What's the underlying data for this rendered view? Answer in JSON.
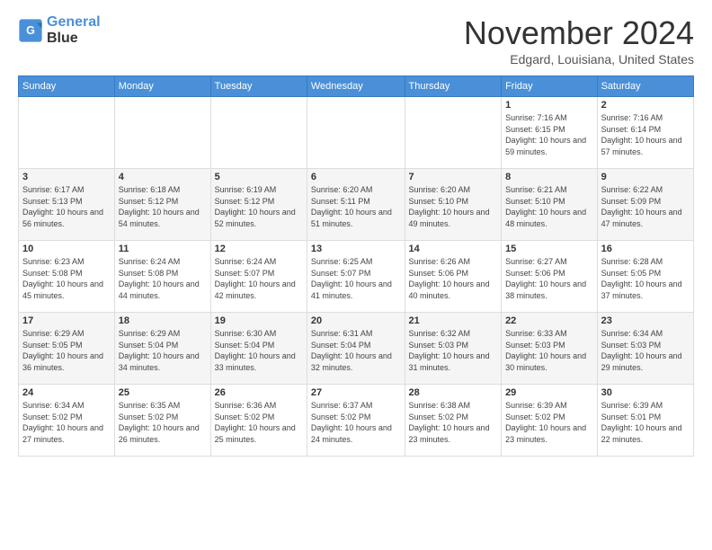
{
  "header": {
    "logo_line1": "General",
    "logo_line2": "Blue",
    "month_title": "November 2024",
    "location": "Edgard, Louisiana, United States"
  },
  "weekdays": [
    "Sunday",
    "Monday",
    "Tuesday",
    "Wednesday",
    "Thursday",
    "Friday",
    "Saturday"
  ],
  "weeks": [
    [
      {
        "day": "",
        "info": ""
      },
      {
        "day": "",
        "info": ""
      },
      {
        "day": "",
        "info": ""
      },
      {
        "day": "",
        "info": ""
      },
      {
        "day": "",
        "info": ""
      },
      {
        "day": "1",
        "info": "Sunrise: 7:16 AM\nSunset: 6:15 PM\nDaylight: 10 hours and 59 minutes."
      },
      {
        "day": "2",
        "info": "Sunrise: 7:16 AM\nSunset: 6:14 PM\nDaylight: 10 hours and 57 minutes."
      }
    ],
    [
      {
        "day": "3",
        "info": "Sunrise: 6:17 AM\nSunset: 5:13 PM\nDaylight: 10 hours and 56 minutes."
      },
      {
        "day": "4",
        "info": "Sunrise: 6:18 AM\nSunset: 5:12 PM\nDaylight: 10 hours and 54 minutes."
      },
      {
        "day": "5",
        "info": "Sunrise: 6:19 AM\nSunset: 5:12 PM\nDaylight: 10 hours and 52 minutes."
      },
      {
        "day": "6",
        "info": "Sunrise: 6:20 AM\nSunset: 5:11 PM\nDaylight: 10 hours and 51 minutes."
      },
      {
        "day": "7",
        "info": "Sunrise: 6:20 AM\nSunset: 5:10 PM\nDaylight: 10 hours and 49 minutes."
      },
      {
        "day": "8",
        "info": "Sunrise: 6:21 AM\nSunset: 5:10 PM\nDaylight: 10 hours and 48 minutes."
      },
      {
        "day": "9",
        "info": "Sunrise: 6:22 AM\nSunset: 5:09 PM\nDaylight: 10 hours and 47 minutes."
      }
    ],
    [
      {
        "day": "10",
        "info": "Sunrise: 6:23 AM\nSunset: 5:08 PM\nDaylight: 10 hours and 45 minutes."
      },
      {
        "day": "11",
        "info": "Sunrise: 6:24 AM\nSunset: 5:08 PM\nDaylight: 10 hours and 44 minutes."
      },
      {
        "day": "12",
        "info": "Sunrise: 6:24 AM\nSunset: 5:07 PM\nDaylight: 10 hours and 42 minutes."
      },
      {
        "day": "13",
        "info": "Sunrise: 6:25 AM\nSunset: 5:07 PM\nDaylight: 10 hours and 41 minutes."
      },
      {
        "day": "14",
        "info": "Sunrise: 6:26 AM\nSunset: 5:06 PM\nDaylight: 10 hours and 40 minutes."
      },
      {
        "day": "15",
        "info": "Sunrise: 6:27 AM\nSunset: 5:06 PM\nDaylight: 10 hours and 38 minutes."
      },
      {
        "day": "16",
        "info": "Sunrise: 6:28 AM\nSunset: 5:05 PM\nDaylight: 10 hours and 37 minutes."
      }
    ],
    [
      {
        "day": "17",
        "info": "Sunrise: 6:29 AM\nSunset: 5:05 PM\nDaylight: 10 hours and 36 minutes."
      },
      {
        "day": "18",
        "info": "Sunrise: 6:29 AM\nSunset: 5:04 PM\nDaylight: 10 hours and 34 minutes."
      },
      {
        "day": "19",
        "info": "Sunrise: 6:30 AM\nSunset: 5:04 PM\nDaylight: 10 hours and 33 minutes."
      },
      {
        "day": "20",
        "info": "Sunrise: 6:31 AM\nSunset: 5:04 PM\nDaylight: 10 hours and 32 minutes."
      },
      {
        "day": "21",
        "info": "Sunrise: 6:32 AM\nSunset: 5:03 PM\nDaylight: 10 hours and 31 minutes."
      },
      {
        "day": "22",
        "info": "Sunrise: 6:33 AM\nSunset: 5:03 PM\nDaylight: 10 hours and 30 minutes."
      },
      {
        "day": "23",
        "info": "Sunrise: 6:34 AM\nSunset: 5:03 PM\nDaylight: 10 hours and 29 minutes."
      }
    ],
    [
      {
        "day": "24",
        "info": "Sunrise: 6:34 AM\nSunset: 5:02 PM\nDaylight: 10 hours and 27 minutes."
      },
      {
        "day": "25",
        "info": "Sunrise: 6:35 AM\nSunset: 5:02 PM\nDaylight: 10 hours and 26 minutes."
      },
      {
        "day": "26",
        "info": "Sunrise: 6:36 AM\nSunset: 5:02 PM\nDaylight: 10 hours and 25 minutes."
      },
      {
        "day": "27",
        "info": "Sunrise: 6:37 AM\nSunset: 5:02 PM\nDaylight: 10 hours and 24 minutes."
      },
      {
        "day": "28",
        "info": "Sunrise: 6:38 AM\nSunset: 5:02 PM\nDaylight: 10 hours and 23 minutes."
      },
      {
        "day": "29",
        "info": "Sunrise: 6:39 AM\nSunset: 5:02 PM\nDaylight: 10 hours and 23 minutes."
      },
      {
        "day": "30",
        "info": "Sunrise: 6:39 AM\nSunset: 5:01 PM\nDaylight: 10 hours and 22 minutes."
      }
    ]
  ]
}
